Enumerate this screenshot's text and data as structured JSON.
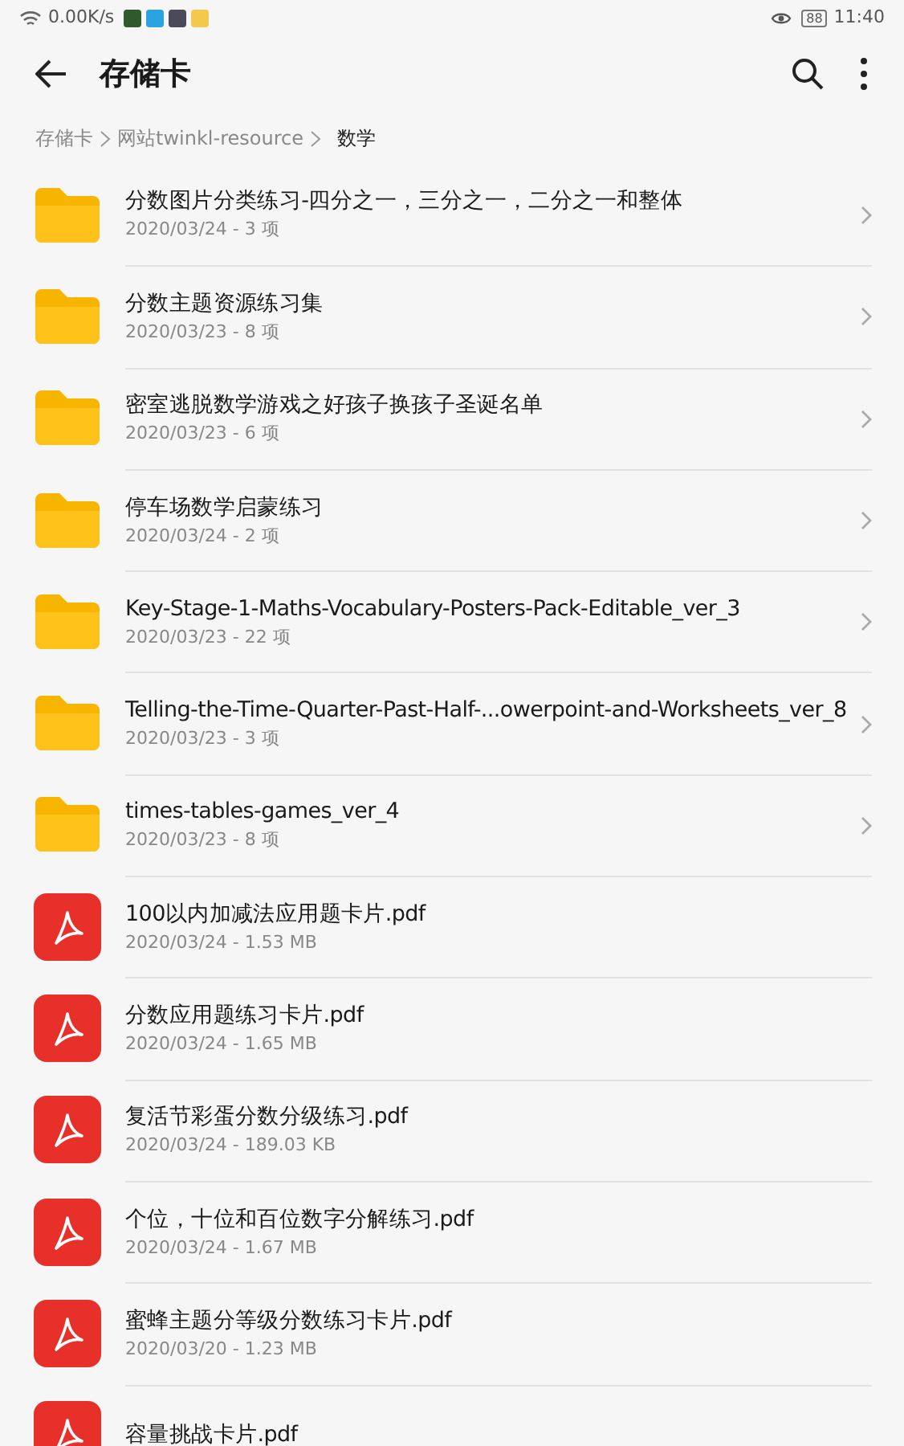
{
  "status_bar": {
    "speed": "0.00K/s",
    "apps": [
      {
        "color": "#2e5a2e"
      },
      {
        "color": "#2aa3e0"
      },
      {
        "color": "#4a4a5a"
      },
      {
        "color": "#f2c94c"
      }
    ],
    "battery": "88",
    "time": "11:40"
  },
  "toolbar": {
    "title": "存储卡"
  },
  "breadcrumb": [
    {
      "label": "存储卡",
      "selected": false
    },
    {
      "label": "网站twinkl-resource",
      "selected": false
    },
    {
      "label": "数学",
      "selected": true
    }
  ],
  "items": [
    {
      "kind": "folder",
      "name": "分数图片分类练习-四分之一，三分之一，二分之一和整体",
      "meta": "2020/03/24 - 3 项"
    },
    {
      "kind": "folder",
      "name": "分数主题资源练习集",
      "meta": "2020/03/23 - 8 项"
    },
    {
      "kind": "folder",
      "name": "密室逃脱数学游戏之好孩子换孩子圣诞名单",
      "meta": "2020/03/23 - 6 项"
    },
    {
      "kind": "folder",
      "name": "停车场数学启蒙练习",
      "meta": "2020/03/24 - 2 项"
    },
    {
      "kind": "folder",
      "name": "Key-Stage-1-Maths-Vocabulary-Posters-Pack-Editable_ver_3",
      "meta": "2020/03/23 - 22 项"
    },
    {
      "kind": "folder",
      "name": "Telling-the-Time-Quarter-Past-Half-...owerpoint-and-Worksheets_ver_8",
      "meta": "2020/03/23 - 3 项"
    },
    {
      "kind": "folder",
      "name": "times-tables-games_ver_4",
      "meta": "2020/03/23 - 8 项"
    },
    {
      "kind": "pdf",
      "name": "100以内加减法应用题卡片.pdf",
      "meta": "2020/03/24 - 1.53 MB"
    },
    {
      "kind": "pdf",
      "name": "分数应用题练习卡片.pdf",
      "meta": "2020/03/24 - 1.65 MB"
    },
    {
      "kind": "pdf",
      "name": "复活节彩蛋分数分级练习.pdf",
      "meta": "2020/03/24 - 189.03 KB"
    },
    {
      "kind": "pdf",
      "name": "个位，十位和百位数字分解练习.pdf",
      "meta": "2020/03/24 - 1.67 MB"
    },
    {
      "kind": "pdf",
      "name": "蜜蜂主题分等级分数练习卡片.pdf",
      "meta": "2020/03/20 - 1.23 MB"
    },
    {
      "kind": "pdf",
      "name": "容量挑战卡片.pdf"
    }
  ]
}
